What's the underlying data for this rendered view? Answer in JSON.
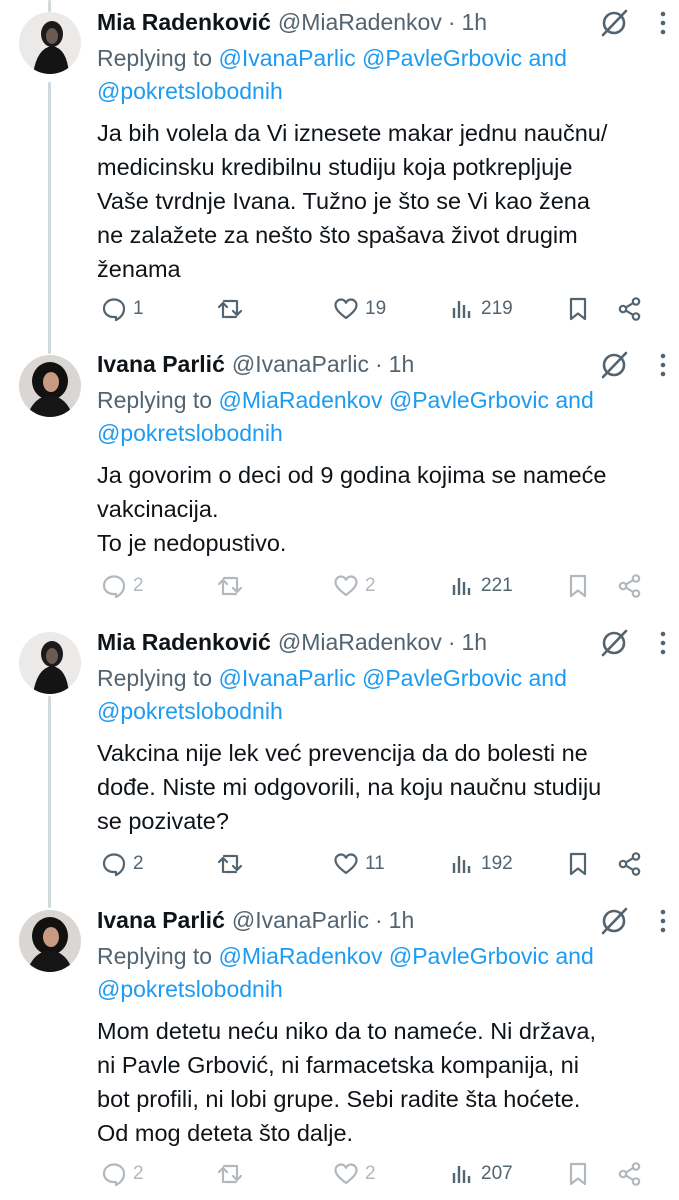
{
  "tweets": [
    {
      "name": "Mia Radenković",
      "handle": "@MiaRadenkov",
      "time": "1h",
      "replying_prefix": "Replying to ",
      "mention1": "@IvanaParlic",
      "mention2": "@PavleGrbovic",
      "and": " and",
      "mention3": "@pokretslobodnih",
      "text": "Ja bih volela da Vi iznesete makar jednu naučnu/\nmedicinsku kredibilnu studiju koja potkrepljuje\nVaše tvrdnje Ivana. Tužno je što se Vi kao žena\nne zalažete za nešto što spašava život drugim\nženama",
      "replies": "1",
      "likes": "19",
      "views": "219",
      "avatar": "mia-avatar"
    },
    {
      "name": "Ivana Parlić",
      "handle": "@IvanaParlic",
      "time": "1h",
      "replying_prefix": "Replying to ",
      "mention1": "@MiaRadenkov",
      "mention2": "@PavleGrbovic",
      "and": " and",
      "mention3": "@pokretslobodnih",
      "text": "Ja govorim o deci od 9 godina kojima se nameće\nvakcinacija.\nTo je nedopustivo.",
      "replies": "2",
      "likes": "2",
      "views": "221",
      "avatar": "ivana-avatar"
    },
    {
      "name": "Mia Radenković",
      "handle": "@MiaRadenkov",
      "time": "1h",
      "replying_prefix": "Replying to ",
      "mention1": "@IvanaParlic",
      "mention2": "@PavleGrbovic",
      "and": " and",
      "mention3": "@pokretslobodnih",
      "text": "Vakcina nije lek već prevencija da do bolesti ne\ndođe. Niste mi odgovorili, na koju naučnu studiju\nse pozivate?",
      "replies": "2",
      "likes": "11",
      "views": "192",
      "avatar": "mia-avatar"
    },
    {
      "name": "Ivana Parlić",
      "handle": "@IvanaParlic",
      "time": "1h",
      "replying_prefix": "Replying to ",
      "mention1": "@MiaRadenkov",
      "mention2": "@PavleGrbovic",
      "and": " and",
      "mention3": "@pokretslobodnih",
      "text": "Mom detetu neću niko da to nameće. Ni država,\nni Pavle Grbović, ni farmacetska kompanija, ni\nbot profili, ni lobi grupe. Sebi radite šta hoćete.\nOd mog deteta što dalje.",
      "replies": "2",
      "likes": "2",
      "views": "207",
      "avatar": "ivana-avatar"
    }
  ],
  "separator": "·",
  "colors": {
    "text": "#0f1419",
    "muted": "#536471",
    "link": "#1d9bf0",
    "thread_line": "#cfd9de"
  }
}
